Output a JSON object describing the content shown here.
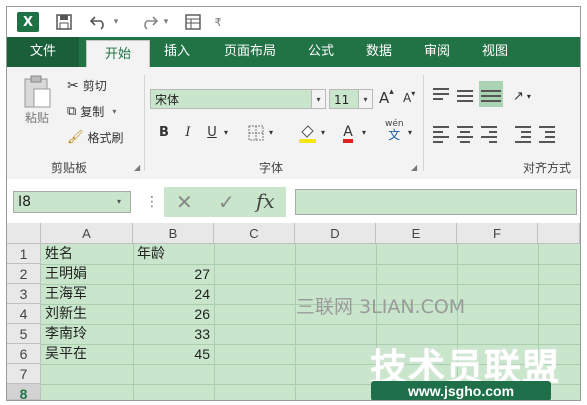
{
  "app": {
    "logo_letter": "X"
  },
  "quick_access": {
    "items": [
      {
        "name": "save-icon",
        "glyph": "💾"
      },
      {
        "name": "undo-icon",
        "glyph": "↶"
      },
      {
        "name": "redo-icon",
        "glyph": "↷"
      },
      {
        "name": "form-icon",
        "glyph": "▦"
      },
      {
        "name": "customize-qat-icon",
        "glyph": "▾"
      }
    ]
  },
  "tabs": [
    {
      "label": "文件"
    },
    {
      "label": "开始"
    },
    {
      "label": "插入"
    },
    {
      "label": "页面布局"
    },
    {
      "label": "公式"
    },
    {
      "label": "数据"
    },
    {
      "label": "审阅"
    },
    {
      "label": "视图"
    }
  ],
  "active_tab": "开始",
  "ribbon": {
    "clipboard": {
      "label": "剪贴板",
      "paste": "粘贴",
      "cut": "剪切",
      "copy": "复制",
      "format_painter": "格式刷"
    },
    "font": {
      "label": "字体",
      "font_name": "宋体",
      "font_size": "11",
      "grow": "A",
      "shrink": "A",
      "bold": "B",
      "italic": "I",
      "underline": "U",
      "fill_glyph": "A",
      "font_color_glyph": "A",
      "phonetic": "wén",
      "phonetic_char": "文"
    },
    "alignment": {
      "label": "对齐方式"
    }
  },
  "formula_bar": {
    "name_box": "I8",
    "cancel_glyph": "✕",
    "enter_glyph": "✓",
    "fx_label": "fx",
    "value": ""
  },
  "sheet": {
    "columns": [
      "A",
      "B",
      "C",
      "D",
      "E",
      "F"
    ],
    "rows": [
      "1",
      "2",
      "3",
      "4",
      "5",
      "6",
      "7",
      "8"
    ],
    "selected_row": "8",
    "cells": {
      "A1": "姓名",
      "B1": "年龄",
      "A2": "王明娟",
      "B2": "27",
      "A3": "王海军",
      "B3": "24",
      "A4": "刘新生",
      "B4": "26",
      "A5": "李南玲",
      "B5": "33",
      "A6": "吴平在",
      "B6": "45"
    }
  },
  "watermarks": {
    "line1": "三联网 3LIAN.COM",
    "line2": "技术员联盟",
    "line3": "www.jsgho.com"
  },
  "colors": {
    "accent": "#217346",
    "cell_fill": "#c9e6cc"
  }
}
